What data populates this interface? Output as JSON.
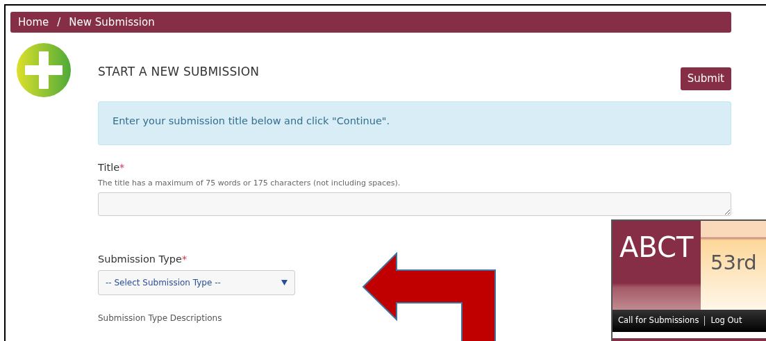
{
  "breadcrumb": [
    {
      "label": "Home"
    },
    {
      "label": "New Submission"
    }
  ],
  "breadcrumb_separator": "/",
  "heading": "START A NEW SUBMISSION",
  "submit_button": "Submit",
  "alert": "Enter your submission title below and click \"Continue\".",
  "title_field": {
    "label": "Title",
    "required_mark": "*",
    "help": "The title has a maximum of 75 words or 175 characters (not including spaces)."
  },
  "type_field": {
    "label": "Submission Type",
    "required_mark": "*",
    "value": "-- Select Submission Type --"
  },
  "descriptions_heading": "Submission Type Descriptions",
  "inset": {
    "logo": "ABCT",
    "banner_text": "53rd",
    "links": [
      {
        "label": "Call for Submissions"
      },
      {
        "label": "Log Out"
      }
    ]
  }
}
